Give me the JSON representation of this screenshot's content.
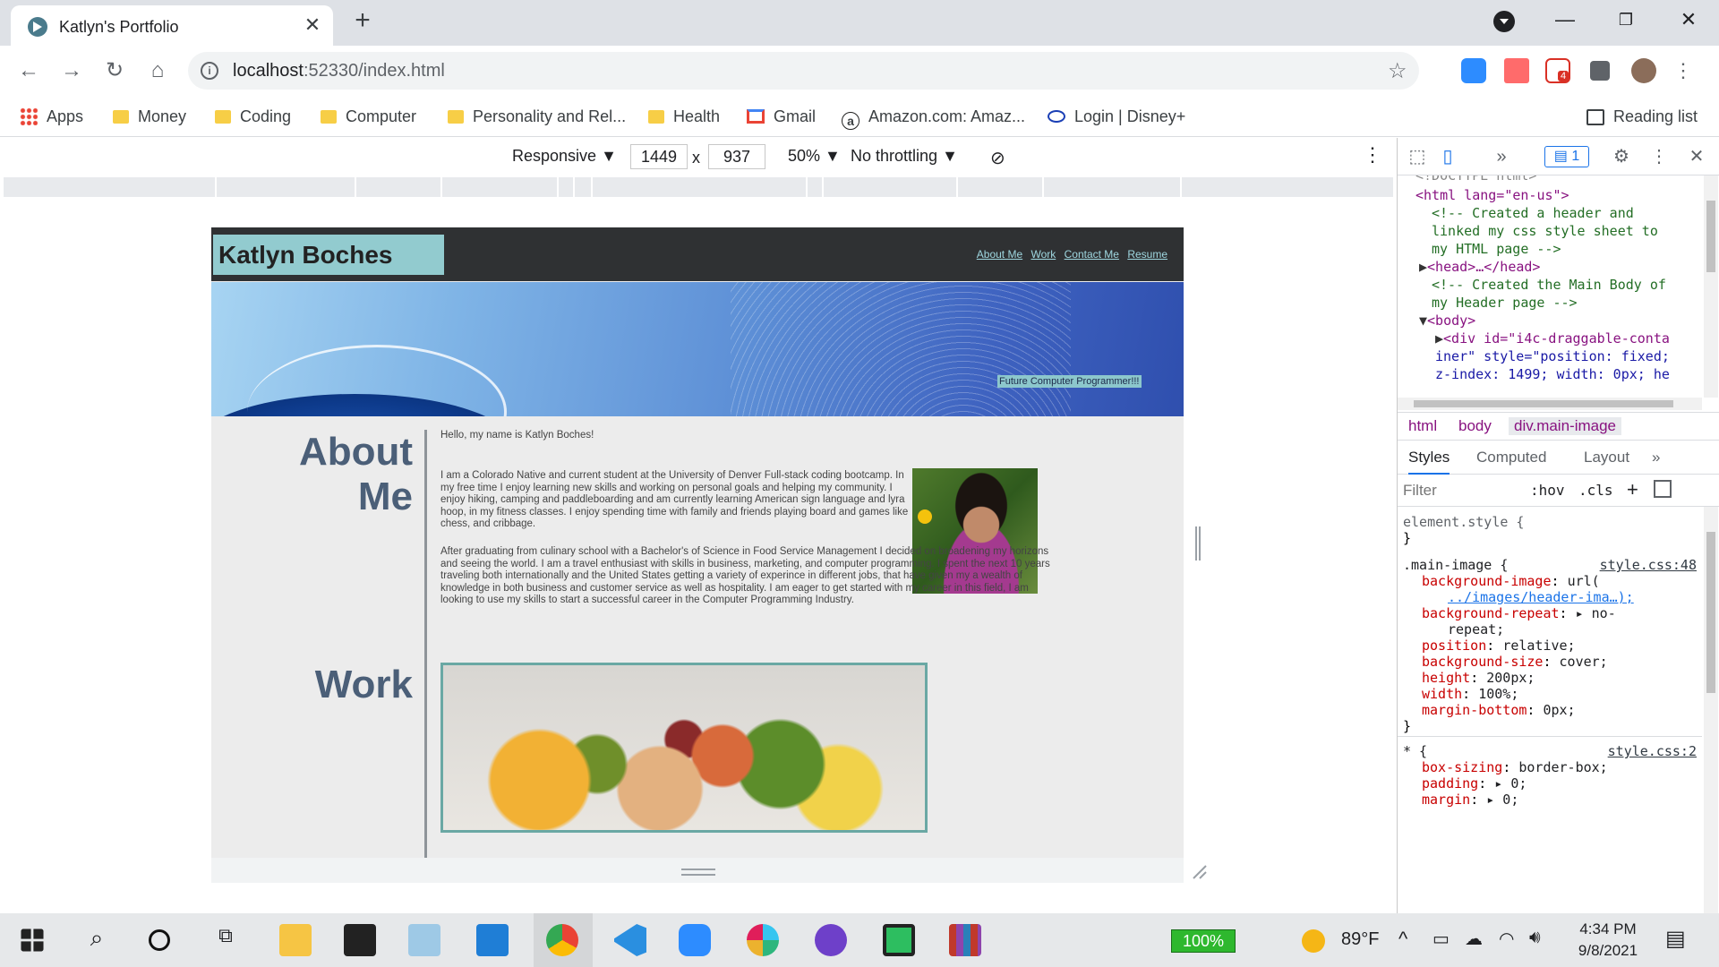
{
  "browser": {
    "tab_title": "Katlyn's Portfolio",
    "url_host": "localhost",
    "url_rest": ":52330/index.html"
  },
  "bookmarks": {
    "apps": "Apps",
    "items": [
      "Money",
      "Coding",
      "Computer",
      "Personality and Rel...",
      "Health",
      "Gmail",
      "Amazon.com: Amaz...",
      "Login | Disney+"
    ],
    "reading_list": "Reading list"
  },
  "extensions": {
    "gmail_badge": "4"
  },
  "device_toolbar": {
    "mode": "Responsive",
    "width": "1449",
    "height": "937",
    "times": "x",
    "zoom": "50%",
    "throttling": "No throttling"
  },
  "site": {
    "name": "Katlyn Boches",
    "nav": [
      "About Me",
      "Work",
      "Contact Me",
      "Resume"
    ],
    "tagline": "Future Computer Programmer!!!",
    "about_title_1": "About",
    "about_title_2": "Me",
    "greeting": "Hello, my name is Katlyn Boches!",
    "bio_1": "I am a Colorado Native and current student at the University of Denver Full-stack coding bootcamp. In my free time I enjoy learning new skills and working on personal goals and helping my community. I enjoy hiking, camping and paddleboarding and am currently learning American sign language and lyra hoop, in my fitness classes. I enjoy spending time with family and friends playing board and games like chess, and cribbage.",
    "bio_2": "After graduating from culinary school with a Bachelor's of Science in Food Service Management I decided on broadening my horizons and seeing the world. I am a travel enthusiast with skills in business, marketing, and computer programming. I spent the next 10 years traveling both internationally and the United States getting a variety of experince in different jobs, that have given my a wealth of knowledge in both business and customer service as well as hospitality. I am eager to get started with my career in this field, I am looking to use my skills to start a successful career in the Computer Programming Industry.",
    "work_title": "Work"
  },
  "devtools": {
    "issues_count": "1",
    "elements": [
      {
        "t": "cut",
        "text": "<!DOCTYPE html>"
      },
      {
        "t": "open",
        "text": "<html lang=\"en-us\">"
      },
      {
        "t": "cmt",
        "text": "<!-- Created a header and"
      },
      {
        "t": "cmt",
        "text": "linked my css style sheet to"
      },
      {
        "t": "cmt",
        "text": "my HTML page -->"
      },
      {
        "t": "head",
        "text": "<head>…</head>"
      },
      {
        "t": "cmt",
        "text": "<!-- Created the Main Body of"
      },
      {
        "t": "cmt",
        "text": "my Header page -->"
      },
      {
        "t": "body",
        "text": "<body>"
      },
      {
        "t": "div",
        "text": "<div id=\"i4c-draggable-conta"
      },
      {
        "t": "div2",
        "text": "iner\" style=\"position: fixed;"
      },
      {
        "t": "div3",
        "text": "z-index: 1499; width: 0px; he"
      }
    ],
    "breadcrumbs": [
      "html",
      "body",
      "div.main-image"
    ],
    "style_tabs": [
      "Styles",
      "Computed",
      "Layout",
      "»"
    ],
    "filter_placeholder": "Filter",
    "hov": ":hov",
    "cls": ".cls",
    "element_style": "element.style {",
    "rule_selector": ".main-image {",
    "rule_source": "style.css:48",
    "rule_props": [
      {
        "p": "background-image",
        "v": "url("
      },
      {
        "p": "",
        "v": "../images/header-ima…);"
      },
      {
        "p": "background-repeat",
        "v": "▸ no-"
      },
      {
        "p": "",
        "v": "repeat;"
      },
      {
        "p": "position",
        "v": "relative;"
      },
      {
        "p": "background-size",
        "v": "cover;"
      },
      {
        "p": "height",
        "v": "200px;"
      },
      {
        "p": "width",
        "v": "100%;"
      },
      {
        "p": "margin-bottom",
        "v": "0px;"
      }
    ],
    "star_selector": "* {",
    "star_source": "style.css:2",
    "star_props": [
      {
        "p": "box-sizing",
        "v": "border-box;"
      },
      {
        "p": "padding",
        "v": "▸ 0;"
      },
      {
        "p": "margin",
        "v": "▸ 0;"
      }
    ]
  },
  "taskbar": {
    "battery": "100%",
    "weather": "89°F",
    "time": "4:34 PM",
    "date": "9/8/2021"
  }
}
